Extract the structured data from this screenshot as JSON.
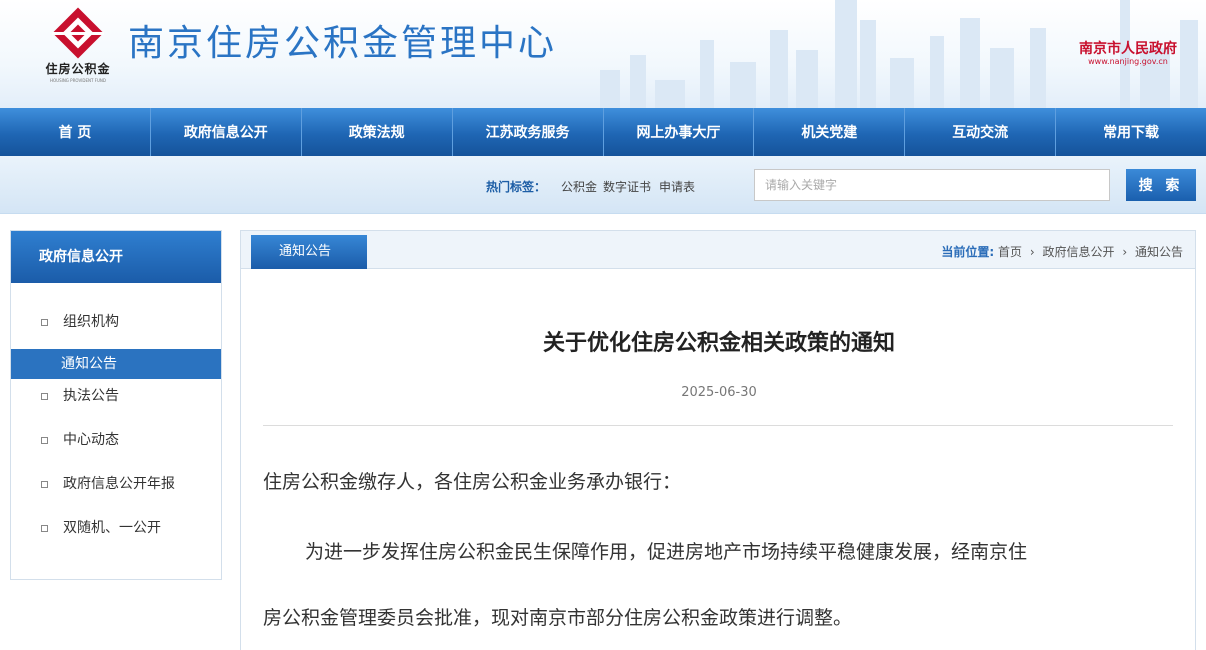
{
  "header": {
    "logo_text": "住房公积金",
    "logo_sub": "HOUSING PROVIDENT FUND",
    "site_title": "南京住房公积金管理中心",
    "gov_name": "南京市人民政府",
    "gov_url": "www.nanjing.gov.cn"
  },
  "nav": {
    "items": [
      {
        "label": "首 页"
      },
      {
        "label": "政府信息公开"
      },
      {
        "label": "政策法规"
      },
      {
        "label": "江苏政务服务"
      },
      {
        "label": "网上办事大厅"
      },
      {
        "label": "机关党建"
      },
      {
        "label": "互动交流"
      },
      {
        "label": "常用下载"
      }
    ]
  },
  "search": {
    "hot_label": "热门标签：",
    "hot_tags": [
      "公积金",
      "数字证书",
      "申请表"
    ],
    "placeholder": "请输入关键字",
    "button_label": "搜 索"
  },
  "sidebar": {
    "title": "政府信息公开",
    "items": [
      {
        "label": "组织机构",
        "active": false
      },
      {
        "label": "通知公告",
        "active": true
      },
      {
        "label": "执法公告",
        "active": false
      },
      {
        "label": "中心动态",
        "active": false
      },
      {
        "label": "政府信息公开年报",
        "active": false
      },
      {
        "label": "双随机、一公开",
        "active": false
      }
    ]
  },
  "content": {
    "tab_label": "通知公告",
    "breadcrumb": {
      "label": "当前位置:",
      "items": [
        "首页",
        "政府信息公开",
        "通知公告"
      ],
      "separator": "›"
    },
    "article": {
      "title": "关于优化住房公积金相关政策的通知",
      "date": "2025-06-30",
      "paragraphs": [
        "住房公积金缴存人，各住房公积金业务承办银行：",
        "为进一步发挥住房公积金民生保障作用，促进房地产市场持续平稳健康发展，经南京住",
        "房公积金管理委员会批准，现对南京市部分住房公积金政策进行调整。"
      ]
    }
  },
  "colors": {
    "brand_blue": "#2a74c4",
    "nav_blue": "#1f66b4",
    "gov_red": "#c8102e",
    "logo_red": "#c8102e"
  }
}
